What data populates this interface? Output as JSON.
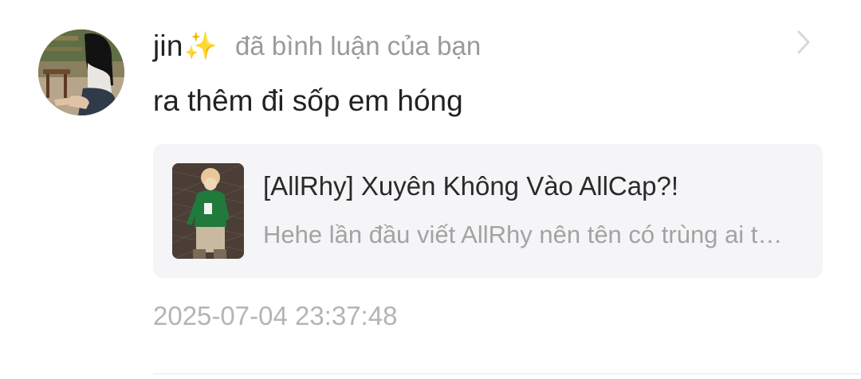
{
  "notification": {
    "user": {
      "name": "jin",
      "name_emoji": "✨"
    },
    "action_text": "đã bình luận của bạn",
    "comment_text": "ra thêm đi sốp em hóng",
    "story": {
      "title": "[AllRhy] Xuyên Không Vào AllCap?!",
      "excerpt": "Hehe lần đầu viết AllRhy nên tên có trùng ai thì mọi người thông cảm nha"
    },
    "timestamp": "2025-07-04 23:37:48",
    "icons": {
      "avatar": "user-avatar-photo",
      "chevron": "chevron-right-icon",
      "cover": "story-cover-thumbnail"
    },
    "colors": {
      "username": "#222222",
      "secondary": "#9a9a9a",
      "card_background": "#f5f5f7",
      "timestamp": "#b4b4b4"
    }
  }
}
